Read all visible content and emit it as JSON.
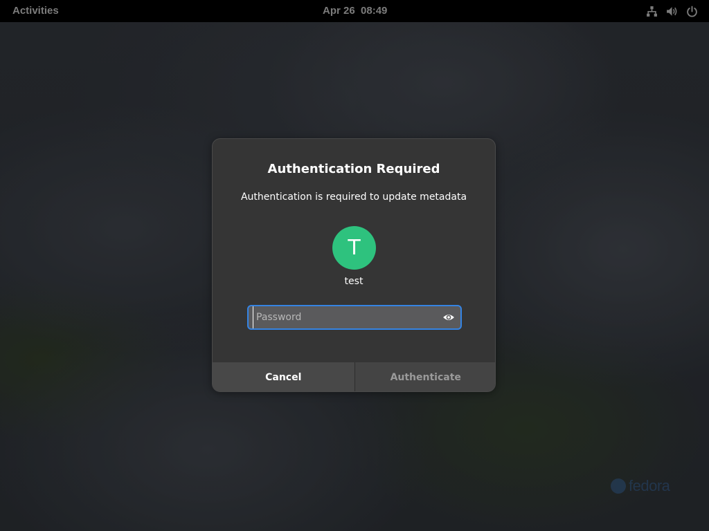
{
  "topbar": {
    "activities_label": "Activities",
    "clock": "Apr 26  08:49",
    "tray_icons": [
      "network-icon",
      "volume-icon",
      "power-icon"
    ]
  },
  "watermark": {
    "text": "fedora"
  },
  "dialog": {
    "title": "Authentication Required",
    "message": "Authentication is required to update metadata",
    "avatar_initial": "T",
    "avatar_color": "#2ec27e",
    "username": "test",
    "password": {
      "value": "",
      "placeholder": "Password"
    },
    "cancel_label": "Cancel",
    "authenticate_label": "Authenticate",
    "accent_color": "#3584e4"
  }
}
